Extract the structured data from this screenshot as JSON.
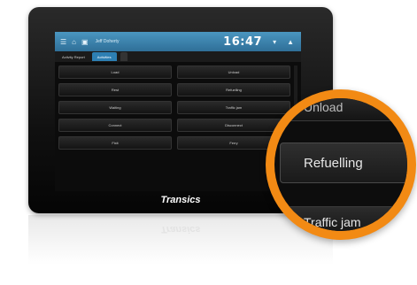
{
  "screen": {
    "topbar": {
      "user": "Jeff Doherty",
      "clock": "16:47",
      "menu_icon": "menu-icon",
      "home_icon": "home-icon",
      "contact_icon": "contact-card-icon"
    },
    "tabs": [
      "Activity Report",
      "Activities"
    ],
    "buttons_left": [
      "Load",
      "Rest",
      "Waiting",
      "Connect",
      "Fixit"
    ],
    "buttons_right": [
      "Unload",
      "Refuelling",
      "Traffic jam",
      "Disconnect",
      "Ferry"
    ]
  },
  "brand": "Transics",
  "zoom": {
    "items": [
      "Unload",
      "Refuelling",
      "Traffic jam"
    ],
    "accent_color": "#f28a14"
  }
}
